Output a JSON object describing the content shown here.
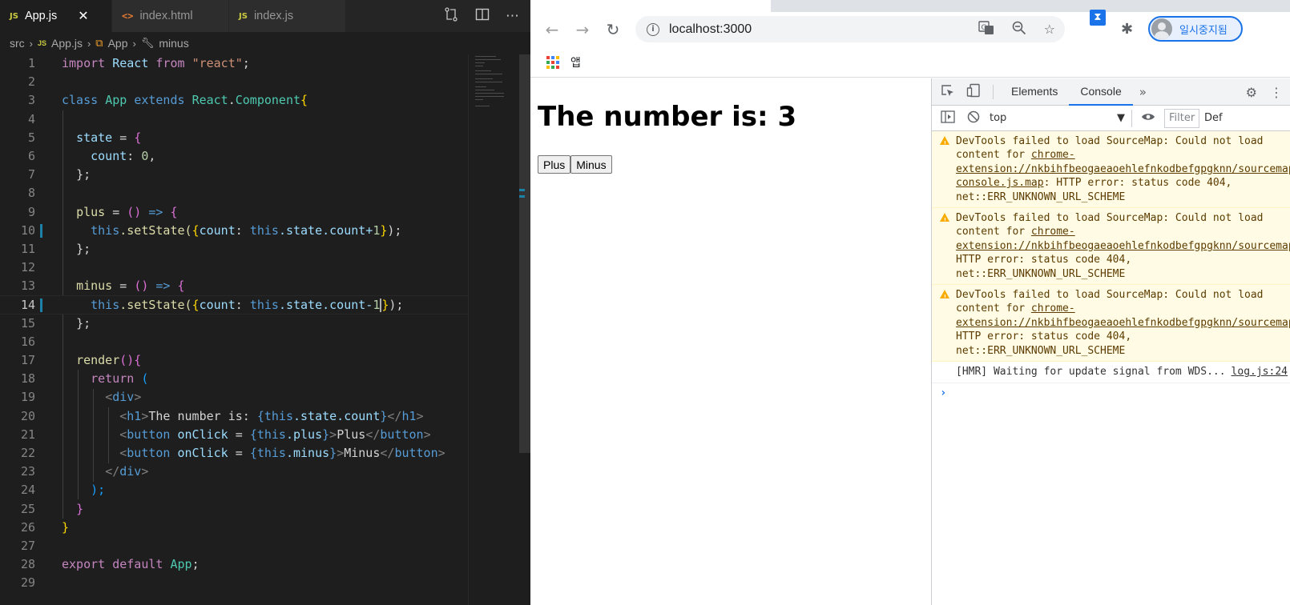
{
  "editor": {
    "tabs": [
      {
        "badge": "JS",
        "label": "App.js",
        "active": true,
        "close": "✕"
      },
      {
        "badge": "<>",
        "label": "index.html"
      },
      {
        "badge": "JS",
        "label": "index.js"
      }
    ],
    "breadcrumb": {
      "folder": "src",
      "file_badge": "JS",
      "file": "App.js",
      "class": "App",
      "method": "minus"
    },
    "line_numbers": [
      "1",
      "2",
      "3",
      "4",
      "5",
      "6",
      "7",
      "8",
      "9",
      "10",
      "11",
      "12",
      "13",
      "14",
      "15",
      "16",
      "17",
      "18",
      "19",
      "20",
      "21",
      "22",
      "23",
      "24",
      "25",
      "26",
      "27",
      "28",
      "29"
    ],
    "code": {
      "l1_import": "import",
      "l1_react": "React",
      "l1_from": "from",
      "l1_str": "\"react\"",
      "l1_semi": ";",
      "l3_class": "class",
      "l3_app": "App",
      "l3_extends": "extends",
      "l3_react": "React",
      "l3_dot": ".",
      "l3_component": "Component",
      "l3_brace": "{",
      "l5_state": "state",
      "l5_eq": " = ",
      "l5_brace": "{",
      "l6_count": "count",
      "l6_colon": ": ",
      "l6_num": "0",
      "l6_comma": ",",
      "l7": "};",
      "l9_plus": "plus",
      "l9_eq": " = ",
      "l9_parens": "()",
      "l9_arrow": " => ",
      "l9_brace": "{",
      "l10_this": "this",
      "l10_set": ".setState(",
      "l10_b1": "{",
      "l10_count": "count",
      "l10_colon": ": ",
      "l10_this2": "this",
      "l10_rest": ".state.count+",
      "l10_num": "1",
      "l10_b2": "}",
      "l10_end": ");",
      "l11": "};",
      "l13_minus": "minus",
      "l13_eq": " = ",
      "l13_parens": "()",
      "l13_arrow": " => ",
      "l13_brace": "{",
      "l14_this": "this",
      "l14_set": ".setState(",
      "l14_b1": "{",
      "l14_count": "count",
      "l14_colon": ": ",
      "l14_this2": "this",
      "l14_rest": ".state.count-",
      "l14_num": "1",
      "l14_b2": "}",
      "l14_end": ");",
      "l15": "};",
      "l17_render": "render",
      "l17_rest": "(){",
      "l18_return": "return",
      "l18_paren": " (",
      "l19_open": "<",
      "l19_tag": "div",
      "l19_close": ">",
      "l20_open": "<",
      "l20_tag": "h1",
      "l20_close": ">",
      "l20_text": "The number is: ",
      "l20_b1": "{",
      "l20_this": "this",
      "l20_rest": ".state.count",
      "l20_b2": "}",
      "l20_end_open": "</",
      "l20_end_tag": "h1",
      "l20_end_close": ">",
      "l21_open": "<",
      "l21_tag": "button",
      "l21_attr": "onClick",
      "l21_eq": " = ",
      "l21_b1": "{",
      "l21_this": "this",
      "l21_rest": ".plus",
      "l21_b2": "}",
      "l21_gt": ">",
      "l21_text": "Plus",
      "l21_end_open": "</",
      "l21_end_tag": "button",
      "l21_end_close": ">",
      "l22_open": "<",
      "l22_tag": "button",
      "l22_attr": "onClick",
      "l22_eq": " = ",
      "l22_b1": "{",
      "l22_this": "this",
      "l22_rest": ".minus",
      "l22_b2": "}",
      "l22_gt": ">",
      "l22_text": "Minus",
      "l22_end_open": "</",
      "l22_end_tag": "button",
      "l22_end_close": ">",
      "l23_open": "</",
      "l23_tag": "div",
      "l23_close": ">",
      "l24": ");",
      "l25": "}",
      "l26": "}",
      "l28_export": "export",
      "l28_default": "default",
      "l28_app": "App",
      "l28_semi": ";"
    }
  },
  "browser": {
    "url": "localhost:3000",
    "bookmarks_label": "앱",
    "profile_name": "일시중지됨",
    "page": {
      "heading": "The number is: 3",
      "plus_label": "Plus",
      "minus_label": "Minus"
    },
    "devtools": {
      "tabs": [
        "Elements",
        "Console"
      ],
      "active_tab": "Console",
      "context": "top",
      "filter_placeholder": "Filter",
      "levels": "Def",
      "messages": [
        {
          "type": "warning",
          "pre": "DevTools failed to load SourceMap: Could not load content for ",
          "link": "chrome-extension://nkbihfbeogaeaoehlefnkodbefgpgknn/sourcemaps/disable-console.js.map",
          "post": ": HTTP error: status code 404, net::ERR_UNKNOWN_URL_SCHEME"
        },
        {
          "type": "warning",
          "pre": "DevTools failed to load SourceMap: Could not load content for ",
          "link": "chrome-extension://nkbihfbeogaeaoehlefnkodbefgpgknn/sourcemaps/contentscript.js.map",
          "post": ": HTTP error: status code 404, net::ERR_UNKNOWN_URL_SCHEME"
        },
        {
          "type": "warning",
          "pre": "DevTools failed to load SourceMap: Could not load content for ",
          "link": "chrome-extension://nkbihfbeogaeaoehlefnkodbefgpgknn/sourcemaps/inpage.js.map",
          "post": ": HTTP error: status code 404, net::ERR_UNKNOWN_URL_SCHEME"
        },
        {
          "type": "log",
          "text": "[HMR] Waiting for update signal from WDS...",
          "source": "log.js:24"
        }
      ],
      "prompt": "›"
    }
  },
  "colors": {
    "accent": "#1a73e8",
    "editor_bg": "#1e1e1e",
    "warning_bg": "#fffbe5"
  }
}
